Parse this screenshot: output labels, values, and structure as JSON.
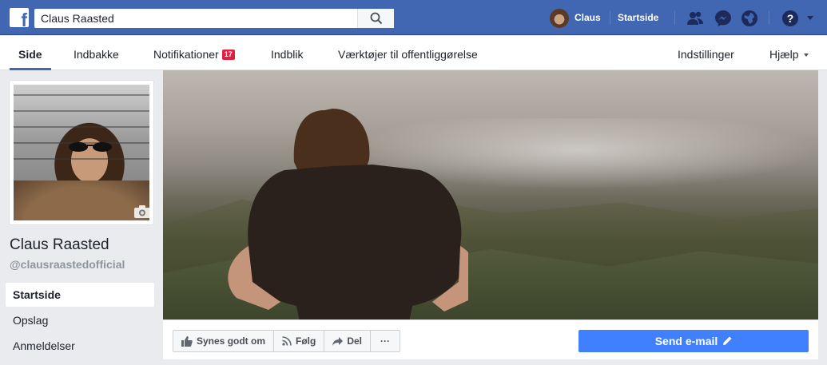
{
  "topbar": {
    "search_value": "Claus Raasted",
    "user_name": "Claus",
    "home_label": "Startside"
  },
  "tabs": [
    {
      "label": "Side"
    },
    {
      "label": "Indbakke"
    },
    {
      "label": "Notifikationer",
      "badge": "17"
    },
    {
      "label": "Indblik"
    },
    {
      "label": "Værktøjer til offentliggørelse"
    },
    {
      "label": "Indstillinger"
    },
    {
      "label": "Hjælp"
    }
  ],
  "page": {
    "name": "Claus Raasted",
    "handle": "@clausraastedofficial"
  },
  "sidebar": {
    "items": [
      {
        "label": "Startside"
      },
      {
        "label": "Opslag"
      },
      {
        "label": "Anmeldelser"
      }
    ]
  },
  "actions": {
    "like": "Synes godt om",
    "follow": "Følg",
    "share": "Del",
    "more": "···",
    "email": "Send e-mail"
  },
  "colors": {
    "brand_blue": "#4267b2",
    "primary_button": "#4080ff",
    "badge_red": "#e41e3f"
  },
  "icons": [
    "facebook-logo-icon",
    "search-icon",
    "friends-icon",
    "messenger-icon",
    "globe-icon",
    "help-icon",
    "camera-icon",
    "thumbs-up-icon",
    "rss-icon",
    "share-arrow-icon",
    "pencil-icon"
  ]
}
